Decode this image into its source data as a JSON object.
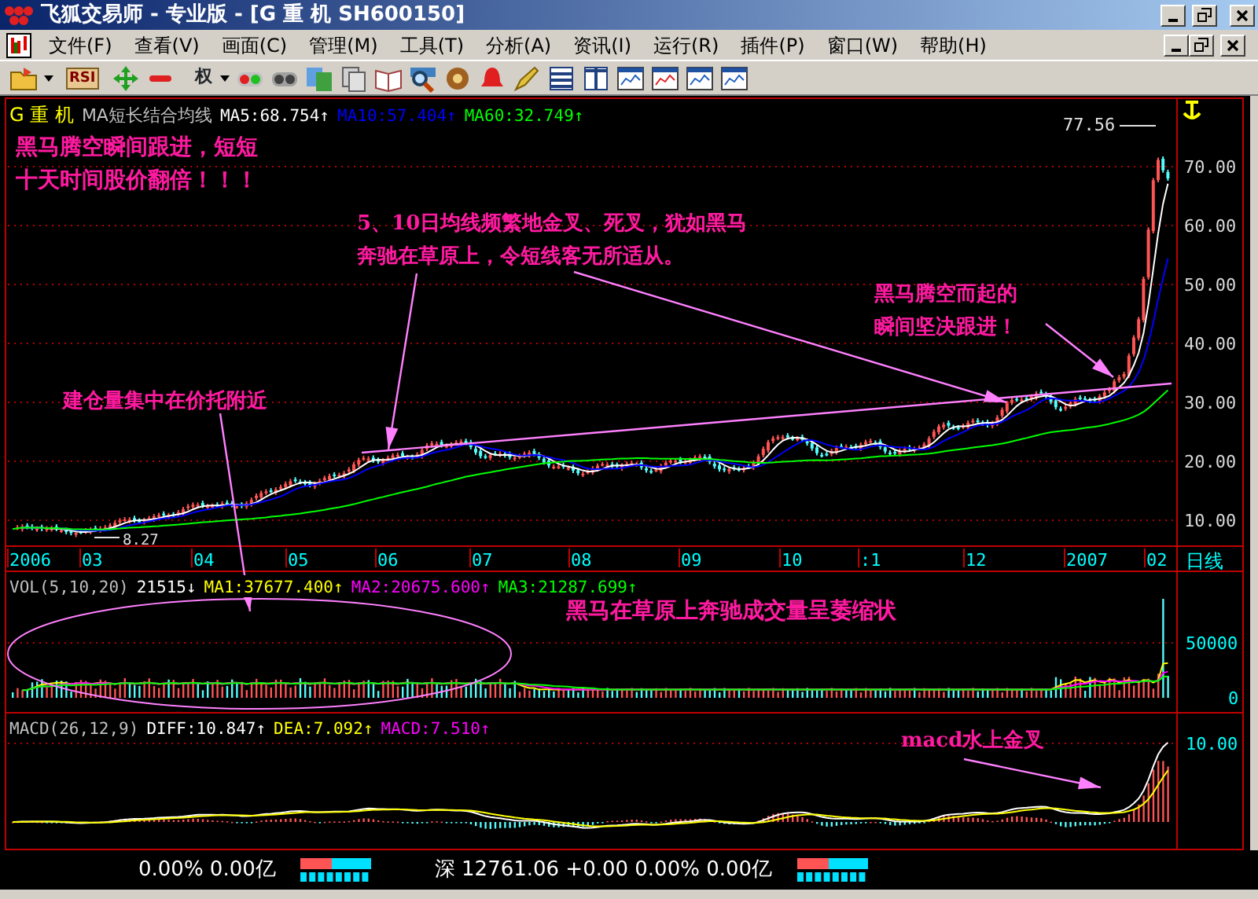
{
  "window": {
    "title": "飞狐交易师 - 专业版 - [G 重  机 SH600150]"
  },
  "menu": [
    "文件(F)",
    "查看(V)",
    "画面(C)",
    "管理(M)",
    "工具(T)",
    "分析(A)",
    "资讯(I)",
    "运行(R)",
    "插件(P)",
    "窗口(W)",
    "帮助(H)"
  ],
  "toolbar": {
    "indicator_button": "RSI",
    "rights_button": "权"
  },
  "price_panel": {
    "stock": "G 重  机",
    "indicator": "MA短长结合均线",
    "averages": [
      {
        "label": "MA5:68.754↑",
        "color": "#ffffff"
      },
      {
        "label": "MA10:57.404↑",
        "color": "#0000ff"
      },
      {
        "label": "MA60:32.749↑",
        "color": "#00ff00"
      }
    ],
    "high_label": "77.56",
    "low_label": "8.27",
    "axis": [
      "70.00",
      "60.00",
      "50.00",
      "40.00",
      "30.00",
      "20.00",
      "10.00"
    ]
  },
  "annotations": [
    {
      "lines": [
        "黑马腾空瞬间跟进，短短",
        "十天时间股价翻倍！！！"
      ]
    },
    {
      "lines": [
        "5、10日均线频繁地金叉、死叉，犹如黑马",
        "奔驰在草原上，令短线客无所适从。"
      ]
    },
    {
      "lines": [
        "黑马腾空而起的",
        "瞬间坚决跟进！"
      ]
    },
    {
      "lines": [
        "建仓量集中在价托附近"
      ]
    },
    {
      "lines": [
        "黑马在草原上奔驰成交量呈萎缩状"
      ]
    },
    {
      "lines": [
        "macd水上金叉"
      ]
    }
  ],
  "date_axis": {
    "labels": [
      "2006",
      "03",
      "04",
      "05",
      "06",
      "07",
      "08",
      "09",
      "10",
      ":1",
      "12",
      "2007",
      "02"
    ],
    "period": "日线"
  },
  "volume_panel": {
    "title": "VOL(5,10,20)",
    "value": "21515↓",
    "averages": [
      {
        "label": "MA1:37677.400↑",
        "color": "#ffff00"
      },
      {
        "label": "MA2:20675.600↑",
        "color": "#ff00ff"
      },
      {
        "label": "MA3:21287.699↑",
        "color": "#00ff00"
      }
    ],
    "axis": [
      "50000",
      "0"
    ]
  },
  "macd_panel": {
    "title": "MACD(26,12,9)",
    "averages": [
      {
        "label": "DIFF:10.847↑",
        "color": "#ffffff"
      },
      {
        "label": "DEA:7.092↑",
        "color": "#ffff00"
      },
      {
        "label": "MACD:7.510↑",
        "color": "#ff00ff"
      }
    ],
    "axis": [
      "10.00"
    ]
  },
  "status_bar": [
    "0.00% 0.00亿",
    "深 12761.06 +0.00 0.00% 0.00亿"
  ]
}
